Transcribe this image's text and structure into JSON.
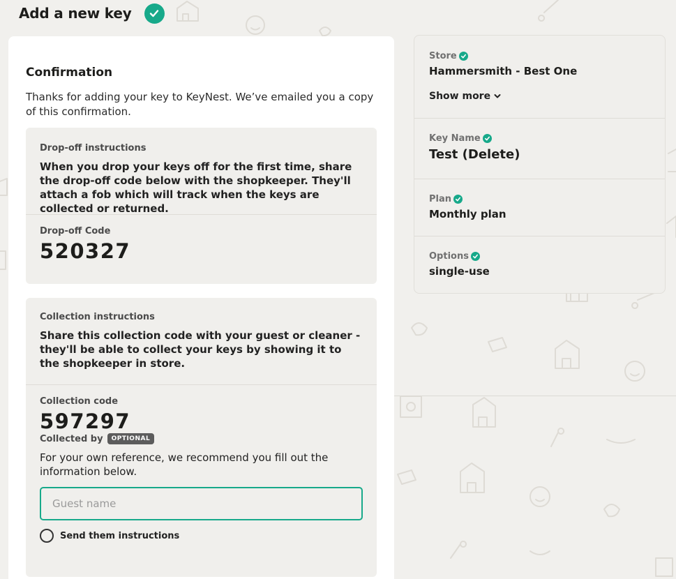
{
  "header": {
    "title": "Add a new key"
  },
  "confirmation": {
    "title": "Confirmation",
    "text": "Thanks for adding your key to KeyNest. We’ve emailed you a copy of this confirmation."
  },
  "dropoff": {
    "label": "Drop-off instructions",
    "instructions": "When you drop your keys off for the first time, share the drop-off code below with the shopkeeper. They'll attach a fob which will track when the keys are collected or returned.",
    "code_label": "Drop-off Code",
    "code": "520327"
  },
  "collection": {
    "label": "Collection instructions",
    "instructions": "Share this collection code with your guest or cleaner - they'll be able to collect your keys by showing it to the shopkeeper in store.",
    "code_label": "Collection code",
    "code": "597297",
    "collected_by_label": "Collected by",
    "optional_badge": "OPTIONAL",
    "reference_text": "For your own reference, we recommend you fill out the information below.",
    "guest_placeholder": "Guest name",
    "guest_value": "",
    "send_instructions_label": "Send them instructions"
  },
  "summary": {
    "store_label": "Store",
    "store_value": "Hammersmith - Best One",
    "show_more": "Show more",
    "key_name_label": "Key Name",
    "key_name_value": "Test (Delete)",
    "plan_label": "Plan",
    "plan_value": "Monthly plan",
    "options_label": "Options",
    "options_value": "single-use"
  },
  "colors": {
    "accent": "#17a98a",
    "background": "#f1f0ed",
    "panel": "#f0efec"
  },
  "icons": [
    "check-circle-icon",
    "chevron-down-icon",
    "radio-icon"
  ]
}
